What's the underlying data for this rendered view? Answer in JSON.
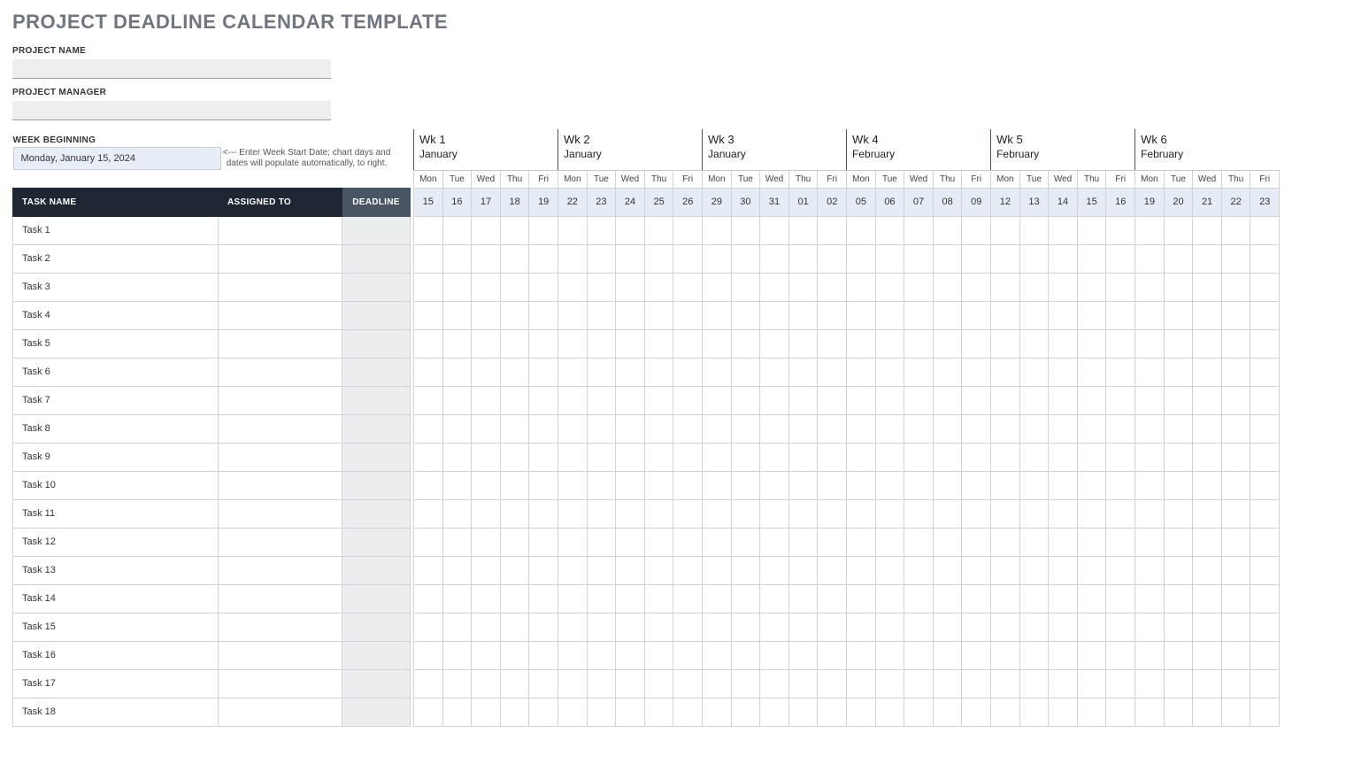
{
  "title": "PROJECT DEADLINE CALENDAR TEMPLATE",
  "labels": {
    "project_name": "PROJECT NAME",
    "project_manager": "PROJECT MANAGER",
    "week_beginning": "WEEK BEGINNING"
  },
  "fields": {
    "project_name": "",
    "project_manager": "",
    "week_start": "Monday, January 15, 2024",
    "week_start_hint": "<--- Enter Week Start Date; chart days and dates will populate automatically, to right."
  },
  "table_headers": {
    "task_name": "TASK NAME",
    "assigned_to": "ASSIGNED TO",
    "deadline": "DEADLINE"
  },
  "dow": [
    "Mon",
    "Tue",
    "Wed",
    "Thu",
    "Fri"
  ],
  "weeks": [
    {
      "label": "Wk 1",
      "month": "January",
      "days": [
        "15",
        "16",
        "17",
        "18",
        "19"
      ]
    },
    {
      "label": "Wk 2",
      "month": "January",
      "days": [
        "22",
        "23",
        "24",
        "25",
        "26"
      ]
    },
    {
      "label": "Wk 3",
      "month": "January",
      "days": [
        "29",
        "30",
        "31",
        "01",
        "02"
      ]
    },
    {
      "label": "Wk 4",
      "month": "February",
      "days": [
        "05",
        "06",
        "07",
        "08",
        "09"
      ]
    },
    {
      "label": "Wk 5",
      "month": "February",
      "days": [
        "12",
        "13",
        "14",
        "15",
        "16"
      ]
    },
    {
      "label": "Wk 6",
      "month": "February",
      "days": [
        "19",
        "20",
        "21",
        "22",
        "23"
      ]
    }
  ],
  "tasks": [
    {
      "name": "Task 1",
      "assigned": "",
      "deadline": ""
    },
    {
      "name": "Task 2",
      "assigned": "",
      "deadline": ""
    },
    {
      "name": "Task 3",
      "assigned": "",
      "deadline": ""
    },
    {
      "name": "Task 4",
      "assigned": "",
      "deadline": ""
    },
    {
      "name": "Task 5",
      "assigned": "",
      "deadline": ""
    },
    {
      "name": "Task 6",
      "assigned": "",
      "deadline": ""
    },
    {
      "name": "Task 7",
      "assigned": "",
      "deadline": ""
    },
    {
      "name": "Task 8",
      "assigned": "",
      "deadline": ""
    },
    {
      "name": "Task 9",
      "assigned": "",
      "deadline": ""
    },
    {
      "name": "Task 10",
      "assigned": "",
      "deadline": ""
    },
    {
      "name": "Task 11",
      "assigned": "",
      "deadline": ""
    },
    {
      "name": "Task 12",
      "assigned": "",
      "deadline": ""
    },
    {
      "name": "Task 13",
      "assigned": "",
      "deadline": ""
    },
    {
      "name": "Task 14",
      "assigned": "",
      "deadline": ""
    },
    {
      "name": "Task 15",
      "assigned": "",
      "deadline": ""
    },
    {
      "name": "Task 16",
      "assigned": "",
      "deadline": ""
    },
    {
      "name": "Task 17",
      "assigned": "",
      "deadline": ""
    },
    {
      "name": "Task 18",
      "assigned": "",
      "deadline": ""
    }
  ]
}
